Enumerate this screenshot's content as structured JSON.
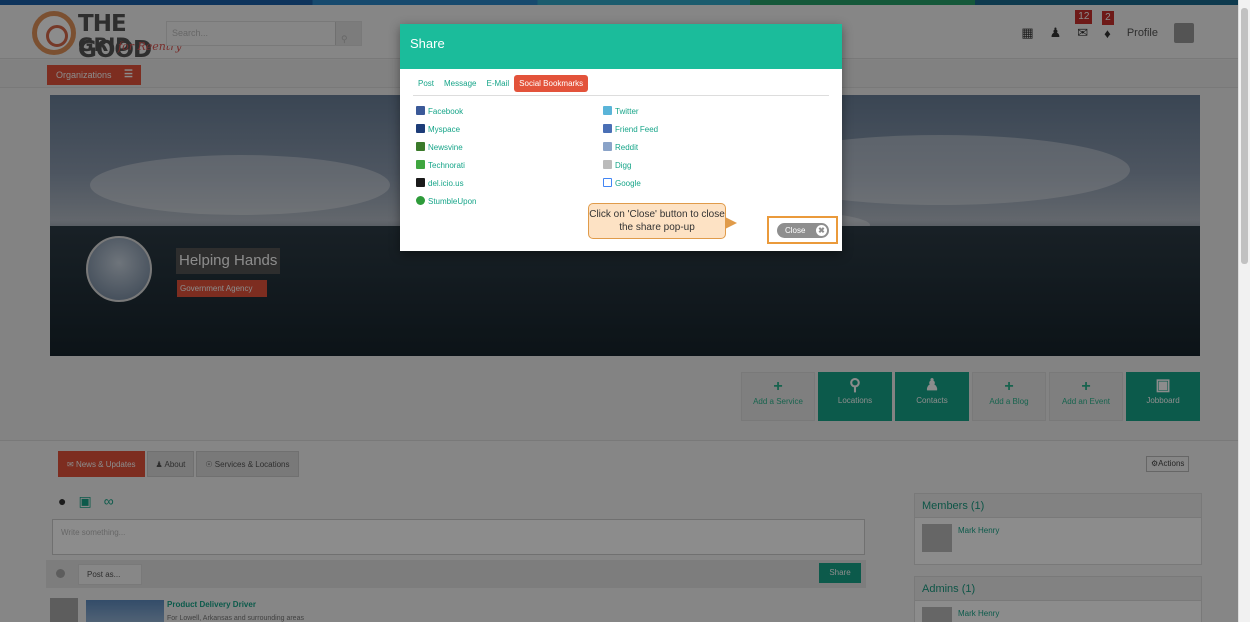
{
  "header": {
    "logo_line1": "THE GOOD",
    "logo_line2": "GRID",
    "logo_tag": "for Reentry",
    "search_placeholder": "Search...",
    "messages_count": "12",
    "notifications_count": "2",
    "profile_label": "Profile"
  },
  "subbar": {
    "organizations_label": "Organizations"
  },
  "profile": {
    "name": "Helping Hands",
    "type": "Government Agency"
  },
  "action_buttons": [
    {
      "label": "Add a Service",
      "icon": "plus-icon",
      "style": "light"
    },
    {
      "label": "Locations",
      "icon": "map-pin-icon",
      "style": "dark"
    },
    {
      "label": "Contacts",
      "icon": "contacts-icon",
      "style": "dark"
    },
    {
      "label": "Add a Blog",
      "icon": "plus-icon",
      "style": "light"
    },
    {
      "label": "Add an Event",
      "icon": "plus-icon",
      "style": "light"
    },
    {
      "label": "Jobboard",
      "icon": "briefcase-icon",
      "style": "dark"
    }
  ],
  "content": {
    "tabs": [
      "News & Updates",
      "About",
      "Services & Locations"
    ],
    "actions_label": "Actions",
    "post_placeholder": "Write something...",
    "post_as": "Post as...",
    "share_label": "Share",
    "feed_title": "Product Delivery Driver",
    "feed_snippet": "For Lowell, Arkansas and surrounding areas"
  },
  "members": {
    "title": "Members (1)",
    "member_name": "Mark Henry"
  },
  "admins": {
    "title": "Admins (1)",
    "admin_name": "Mark Henry"
  },
  "modal": {
    "title": "Share",
    "tabs": [
      "Post",
      "Message",
      "E-Mail",
      "Social Bookmarks"
    ],
    "active_tab": "Social Bookmarks",
    "links_left": [
      "Facebook",
      "Myspace",
      "Newsvine",
      "Technorati",
      "del.icio.us",
      "StumbleUpon"
    ],
    "links_right": [
      "Twitter",
      "Friend Feed",
      "Reddit",
      "Digg",
      "Google"
    ],
    "callout_text": "Click on 'Close' button to close the share pop-up",
    "close_label": "Close"
  },
  "colors": {
    "accent": "#1bbc9b",
    "brand_red": "#e3533b",
    "callout_border": "#ea9a3b"
  }
}
